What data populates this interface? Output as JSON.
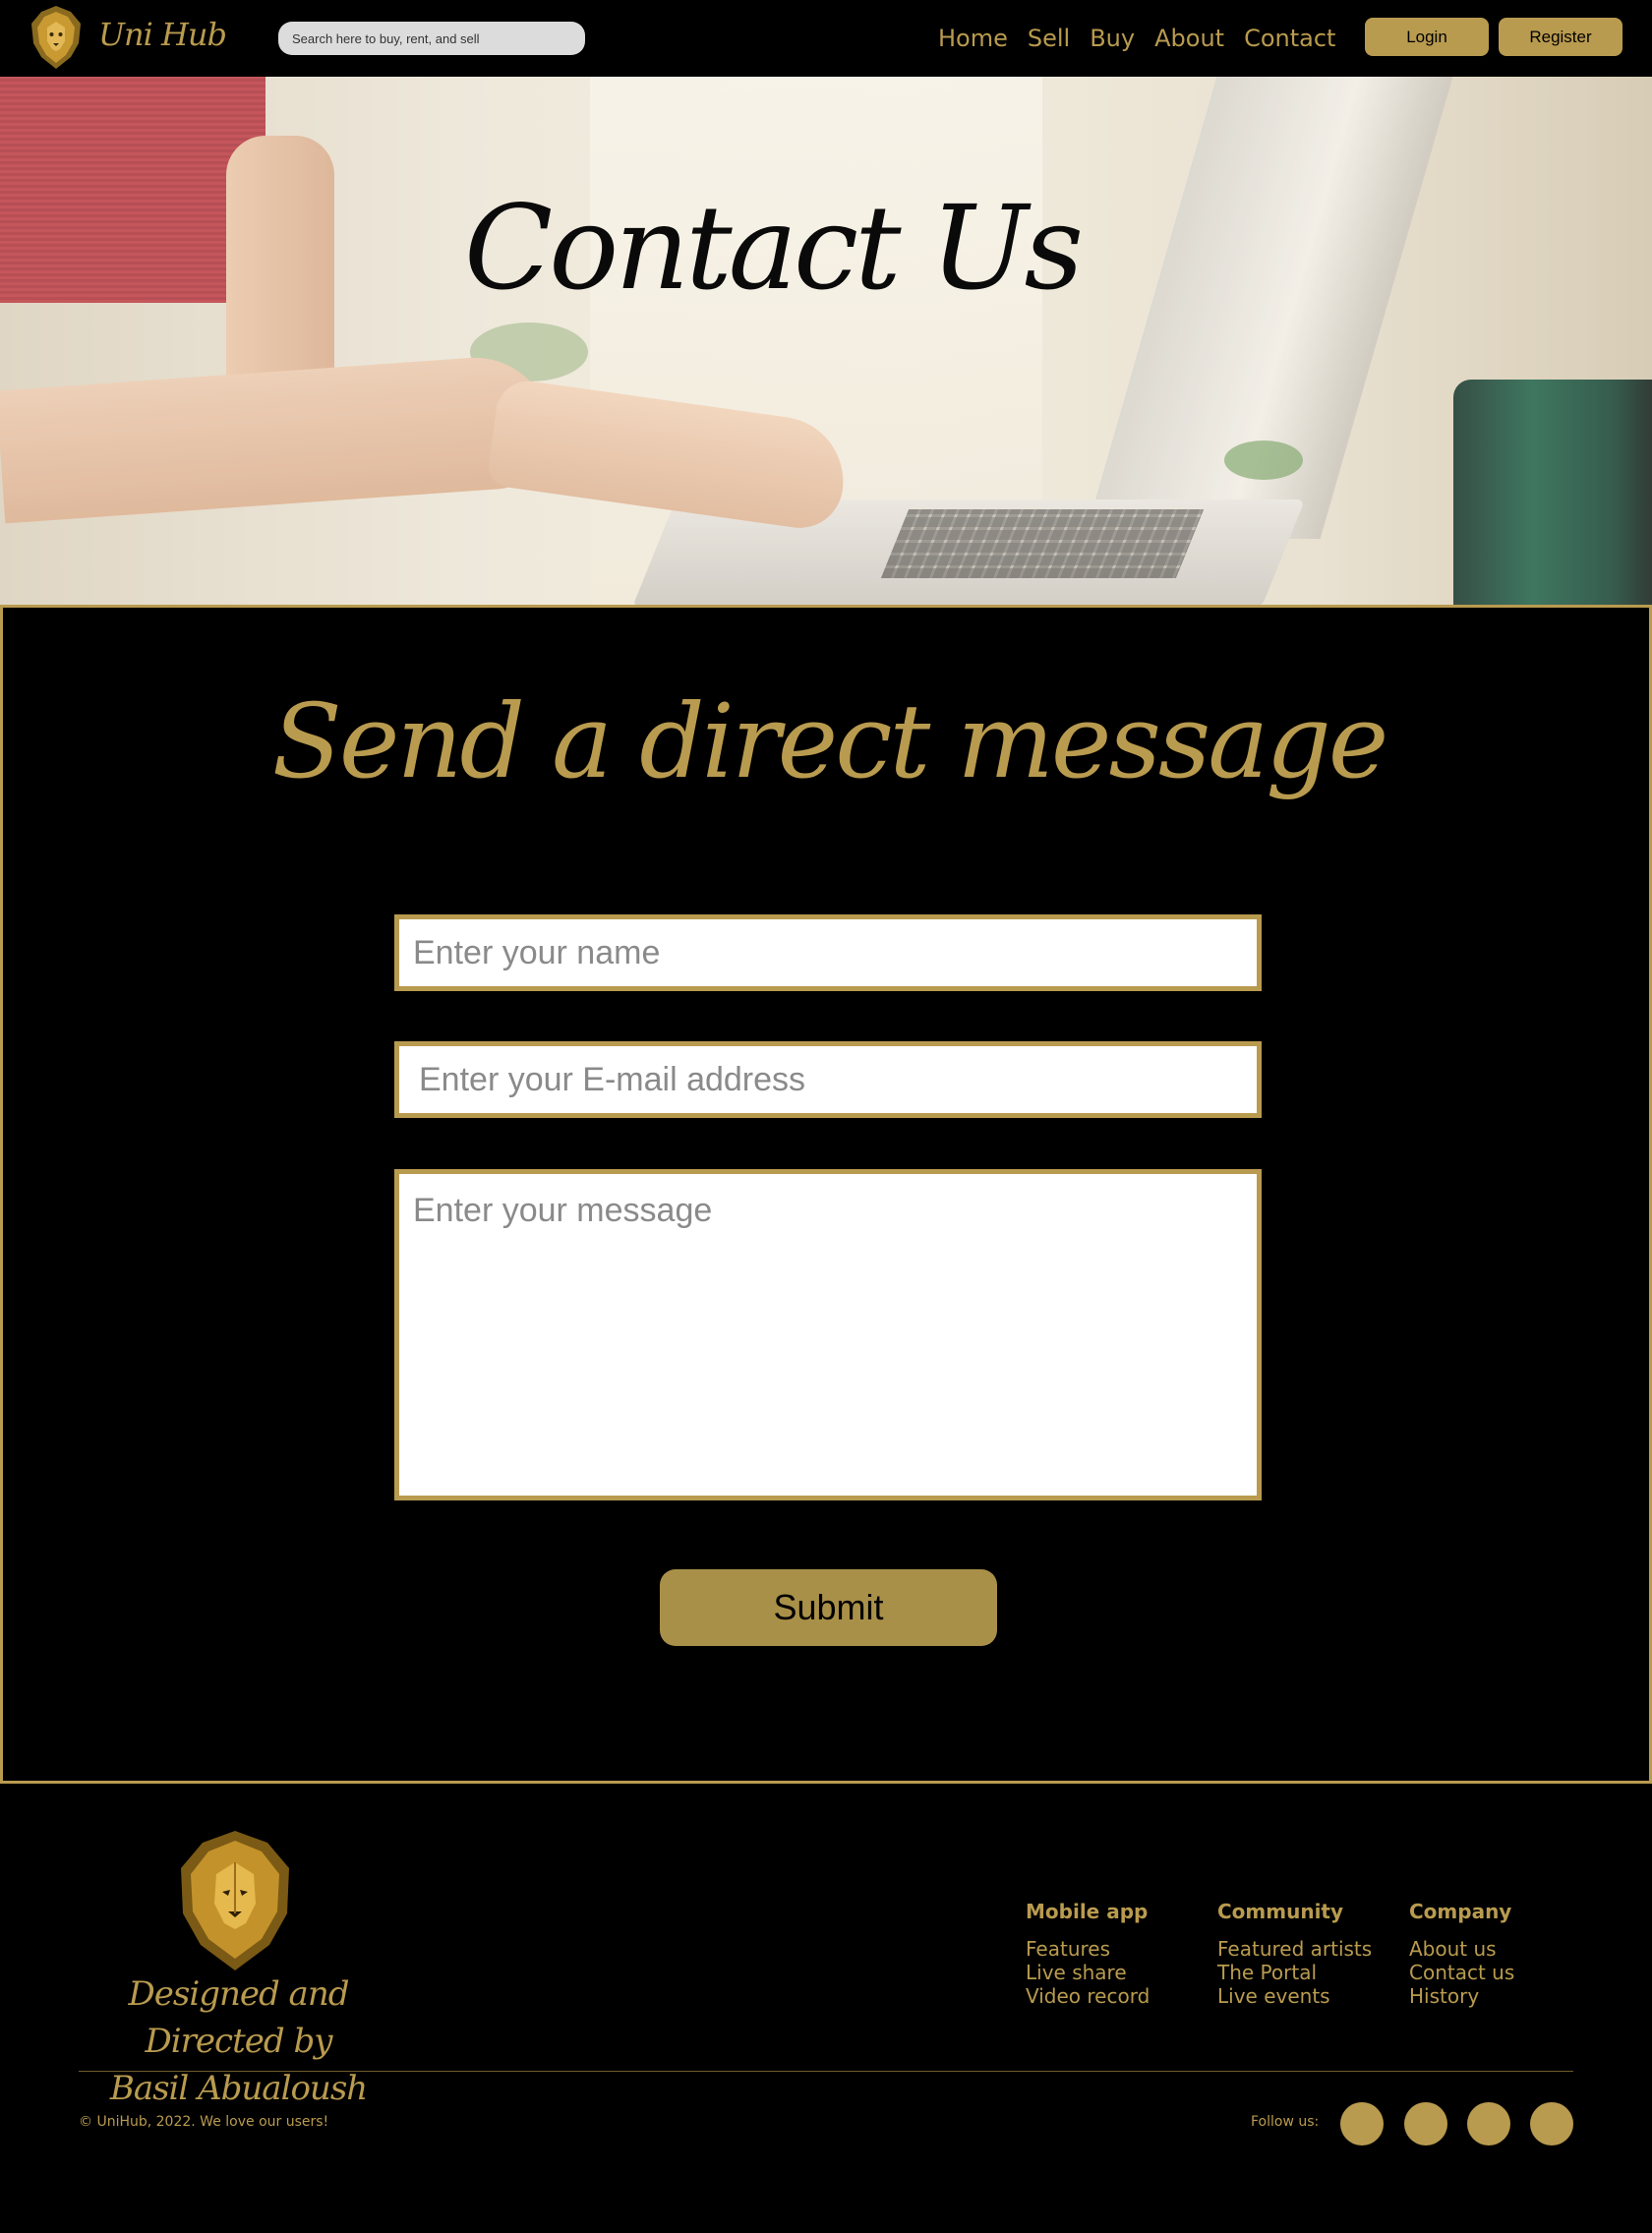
{
  "header": {
    "brand": "Uni Hub",
    "search_placeholder": "Search here to buy, rent, and sell",
    "nav": [
      "Home",
      "Sell",
      "Buy",
      "About",
      "Contact"
    ],
    "login_label": "Login",
    "register_label": "Register"
  },
  "hero": {
    "title": "Contact Us"
  },
  "contact": {
    "title": "Send a direct message",
    "name_placeholder": "Enter your name",
    "email_placeholder": "Enter your E-mail address",
    "message_placeholder": "Enter your message",
    "submit_label": "Submit"
  },
  "footer": {
    "signature_line1": "Designed and Directed by",
    "signature_line2": "Basil Abualoush",
    "columns": [
      {
        "heading": "Mobile app",
        "links": [
          "Features",
          "Live share",
          "Video record"
        ]
      },
      {
        "heading": "Community",
        "links": [
          "Featured artists",
          "The Portal",
          "Live events"
        ]
      },
      {
        "heading": "Company",
        "links": [
          "About us",
          "Contact us",
          "History"
        ]
      }
    ],
    "copyright": "© UniHub, 2022. We love our users!",
    "follow_label": "Follow us:"
  },
  "colors": {
    "accent_gold": "#b99b4f",
    "background": "#000000",
    "submit_gold": "#a99049"
  },
  "icons": [
    "lion-logo-icon",
    "social-icon-1",
    "social-icon-2",
    "social-icon-3",
    "social-icon-4"
  ]
}
